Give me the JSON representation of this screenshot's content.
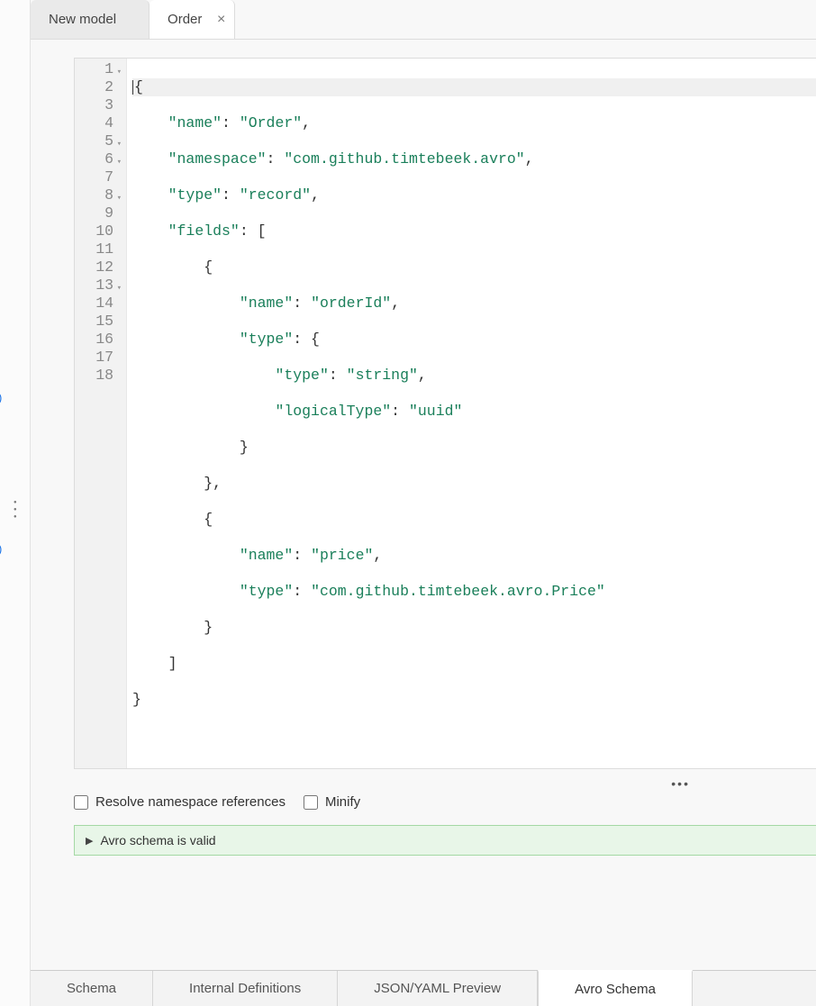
{
  "topTabs": [
    {
      "label": "New model",
      "closable": false,
      "active": false
    },
    {
      "label": "Order",
      "closable": true,
      "active": true
    }
  ],
  "editor": {
    "foldableLines": [
      1,
      5,
      6,
      8,
      13
    ],
    "lineCount": 18,
    "code": {
      "l1": "{",
      "l2_k": "\"name\"",
      "l2_v": "\"Order\"",
      "l3_k": "\"namespace\"",
      "l3_v": "\"com.github.timtebeek.avro\"",
      "l4_k": "\"type\"",
      "l4_v": "\"record\"",
      "l5_k": "\"fields\"",
      "l7_k": "\"name\"",
      "l7_v": "\"orderId\"",
      "l8_k": "\"type\"",
      "l9_k": "\"type\"",
      "l9_v": "\"string\"",
      "l10_k": "\"logicalType\"",
      "l10_v": "\"uuid\"",
      "l14_k": "\"name\"",
      "l14_v": "\"price\"",
      "l15_k": "\"type\"",
      "l15_v": "\"com.github.timtebeek.avro.Price\""
    }
  },
  "options": {
    "resolveNamespace": {
      "label": "Resolve namespace references",
      "checked": false
    },
    "minify": {
      "label": "Minify",
      "checked": false
    }
  },
  "status": {
    "message": "Avro schema is valid"
  },
  "bottomTabs": [
    {
      "label": "Schema",
      "active": false
    },
    {
      "label": "Internal Definitions",
      "active": false
    },
    {
      "label": "JSON/YAML Preview",
      "active": false
    },
    {
      "label": "Avro Schema",
      "active": true
    }
  ],
  "leftRail": {
    "glyph": ")"
  }
}
